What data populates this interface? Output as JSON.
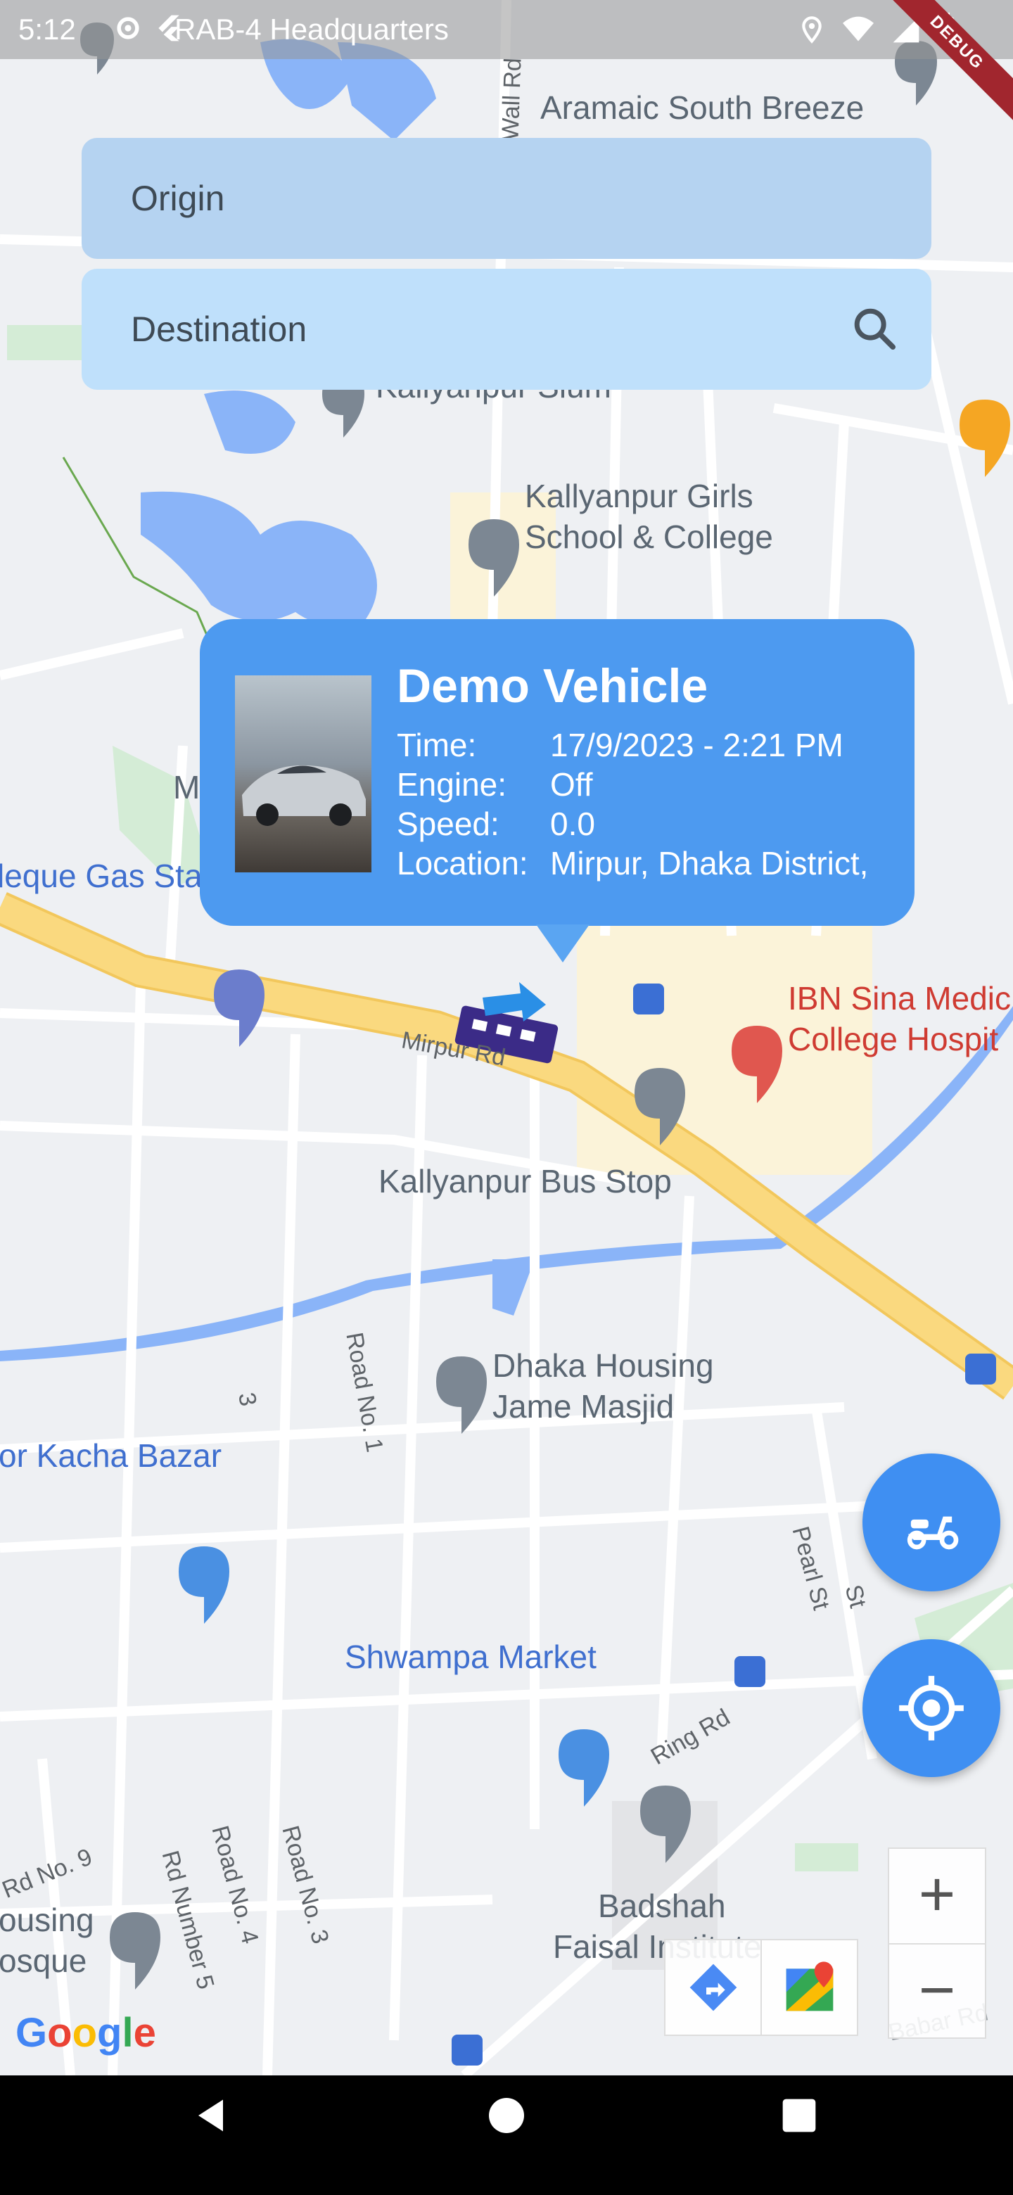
{
  "status_bar": {
    "time": "5:12",
    "overlay_place": "RAB-4 Headquarters",
    "debug_banner": "DEBUG"
  },
  "search": {
    "origin_placeholder": "Origin",
    "destination_placeholder": "Destination"
  },
  "info_window": {
    "title": "Demo Vehicle",
    "rows": [
      {
        "label": "Time:",
        "value": "17/9/2023 - 2:21 PM"
      },
      {
        "label": "Engine:",
        "value": "Off"
      },
      {
        "label": "Speed:",
        "value": "0.0"
      },
      {
        "label": "Location:",
        "value": "Mirpur, Dhaka District,"
      }
    ]
  },
  "map_labels": {
    "aramaic": "Aramaic South Breeze",
    "kallyanpur_slum": "Kallyanpur Slum",
    "girls_school_1": "Kallyanpur Girls",
    "girls_school_2": "School & College",
    "gas_station": "leque Gas Sta",
    "ibn_sina_1": "IBN Sina Medic",
    "ibn_sina_2": "College Hospit",
    "mirpur_rd": "Mirpur Rd",
    "bus_stop": "Kallyanpur Bus Stop",
    "housing_1": "Dhaka Housing",
    "housing_2": "Jame Masjid",
    "kacha_bazar": "or Kacha Bazar",
    "shwampa": "Shwampa Market",
    "badshah_1": "Badshah",
    "badshah_2": "Faisal Institute",
    "ring_rd": "Ring Rd",
    "pearl_st": "Pearl St",
    "road_no_1": "Road No. 1",
    "road_no_3": "Road No. 3",
    "road_no_4": "Road No. 4",
    "rd_number_5": "Rd Number 5",
    "rd_no_9": "Rd No. 9",
    "ousing": "ousing",
    "osque": "osque",
    "wall_rd": "al Wall Rd",
    "m_label": "M",
    "num_3": "3",
    "st_label": "St",
    "babar_rd": "Babar Rd"
  },
  "zoom": {
    "plus": "+",
    "minus": "−"
  },
  "google_logo": "Google",
  "icons": [
    "search-icon",
    "scooter-icon",
    "my-location-icon",
    "directions-icon",
    "google-maps-icon",
    "back-icon",
    "home-icon",
    "recents-icon"
  ],
  "colors": {
    "accent": "#3f8ff2",
    "info_bg": "#4d9af0",
    "origin_bg": "#b5d3f1",
    "destination_bg": "#bfe0fb",
    "road_major": "#fad97f",
    "water": "#8ab4f8"
  }
}
